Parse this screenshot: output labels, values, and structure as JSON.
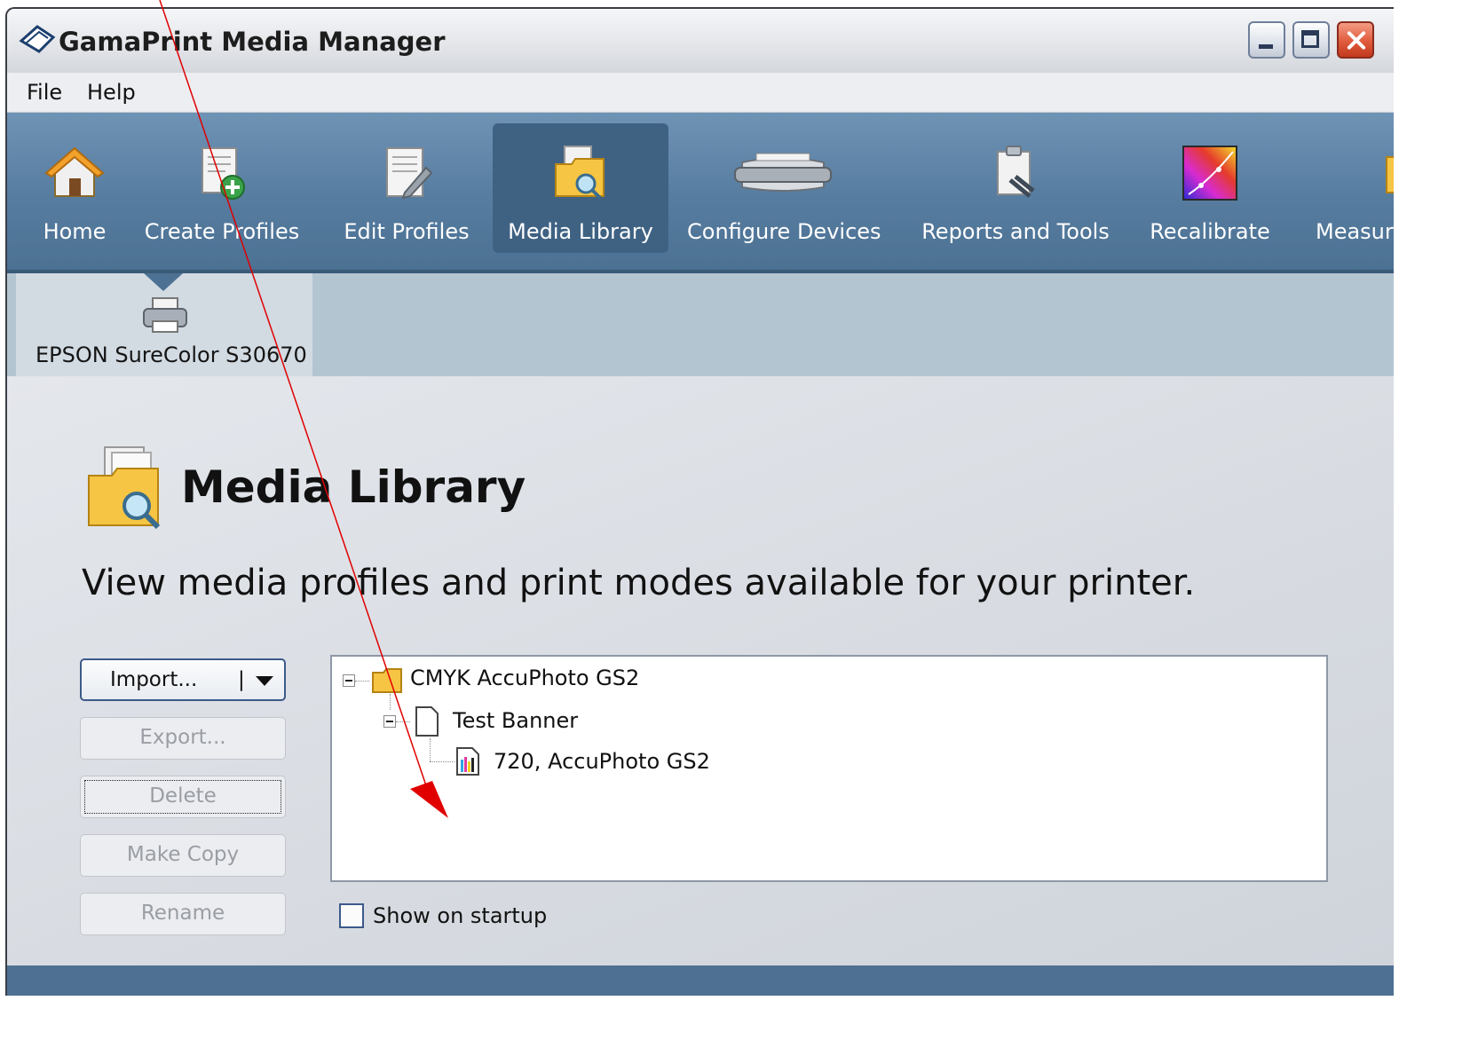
{
  "window": {
    "title": "GamaPrint Media Manager",
    "controls": [
      "minimize",
      "maximize",
      "close"
    ]
  },
  "menu": [
    "File",
    "Help"
  ],
  "toolbar": {
    "items": [
      {
        "label": "Home",
        "icon": "home-icon"
      },
      {
        "label": "Create Profiles",
        "icon": "create-profile-icon"
      },
      {
        "label": "Edit Profiles",
        "icon": "edit-profile-icon"
      },
      {
        "label": "Media Library",
        "icon": "media-library-icon",
        "active": true
      },
      {
        "label": "Configure Devices",
        "icon": "printer-icon"
      },
      {
        "label": "Reports and Tools",
        "icon": "reports-tools-icon"
      },
      {
        "label": "Recalibrate",
        "icon": "recalibrate-icon"
      },
      {
        "label": "Measure",
        "icon": "measure-icon"
      }
    ]
  },
  "device": {
    "label": "EPSON SureColor S30670",
    "icon": "printer-icon"
  },
  "page": {
    "title": "Media Library",
    "subtitle": "View media profiles and print modes available for your printer."
  },
  "buttons": {
    "import": "Import...",
    "import_sep": "|",
    "export": "Export...",
    "delete": "Delete",
    "copy": "Make Copy",
    "rename": "Rename"
  },
  "tree": {
    "root": "CMYK AccuPhoto GS2",
    "child": "Test Banner",
    "leaf": "720, AccuPhoto GS2"
  },
  "startup": {
    "label": "Show on startup",
    "checked": false
  },
  "colors": {
    "toolbar": "#567c9f",
    "active_tool": "#3f6283",
    "device_strip": "#b4c5d2",
    "annotation_arrow": "#e00000"
  }
}
